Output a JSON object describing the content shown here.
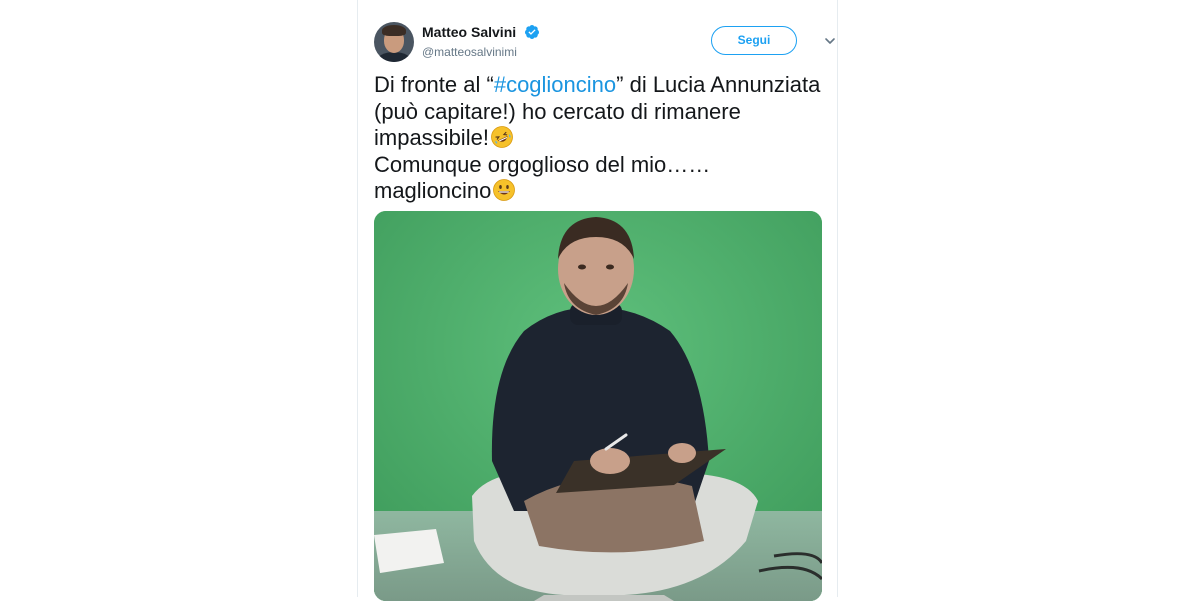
{
  "author": {
    "name": "Matteo Salvini",
    "handle": "@matteosalvinimi",
    "verified": true
  },
  "actions": {
    "follow_label": "Segui",
    "more_icon": "chevron-down-icon"
  },
  "tweet": {
    "line1_prefix": "Di fronte al “",
    "hashtag": "#coglioncino",
    "line1_suffix": "” di Lucia Annunziata (può capitare!) ho cercato di rimanere impassibile!",
    "line2": "Comunque orgoglioso del mio…… maglioncino"
  },
  "media": {
    "type": "image",
    "icon": "tweet-photo"
  },
  "colors": {
    "accent": "#1da1f2",
    "hashtag": "#1b95e0",
    "text": "#14171a",
    "muted": "#657786"
  }
}
